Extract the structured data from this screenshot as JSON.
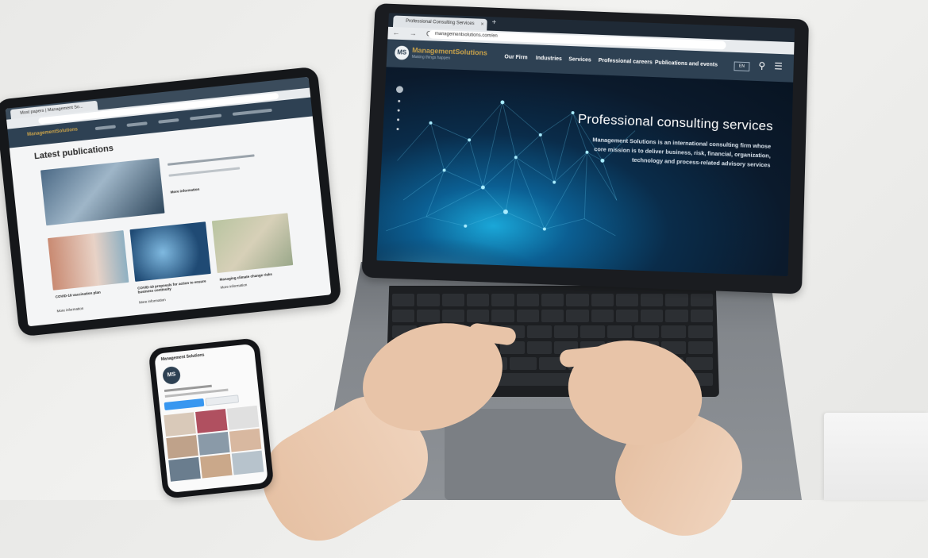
{
  "laptop": {
    "browser_tab_title": "Professional Consulting Services",
    "browser_tab_close": "×",
    "browser_new_tab": "+",
    "nav_glyphs": "← → C ⌂",
    "url": "managementsolutions.com/en",
    "logo_initials": "MS",
    "logo_name": "ManagementSolutions",
    "logo_tagline": "Making things happen",
    "nav_items": [
      "Our Firm",
      "Industries",
      "Services",
      "Professional careers",
      "Publications and events"
    ],
    "language": "EN",
    "hero_title": "Professional consulting services",
    "hero_subtitle": "Management Solutions is an international consulting firm whose core mission is to deliver business, risk, financial, organization, technology and process-related advisory services"
  },
  "tablet": {
    "tab_title": "Most papers | Management So...",
    "logo_name": "ManagementSolutions",
    "section_title": "Latest publications",
    "cards": [
      {
        "title": "COVID-19 vaccination plan",
        "link": "More information"
      },
      {
        "title": "COVID-19 proposals for action to ensure business continuity",
        "link": "More information"
      },
      {
        "title": "Managing climate change risks",
        "link": "More information"
      }
    ],
    "featured_link": "More information"
  },
  "phone": {
    "title": "Management Solutions",
    "avatar": "MS"
  },
  "colors": {
    "nav_bg": "#2e4153",
    "brand_gold": "#c9a24a",
    "hero_glow": "#1aa7d8"
  }
}
